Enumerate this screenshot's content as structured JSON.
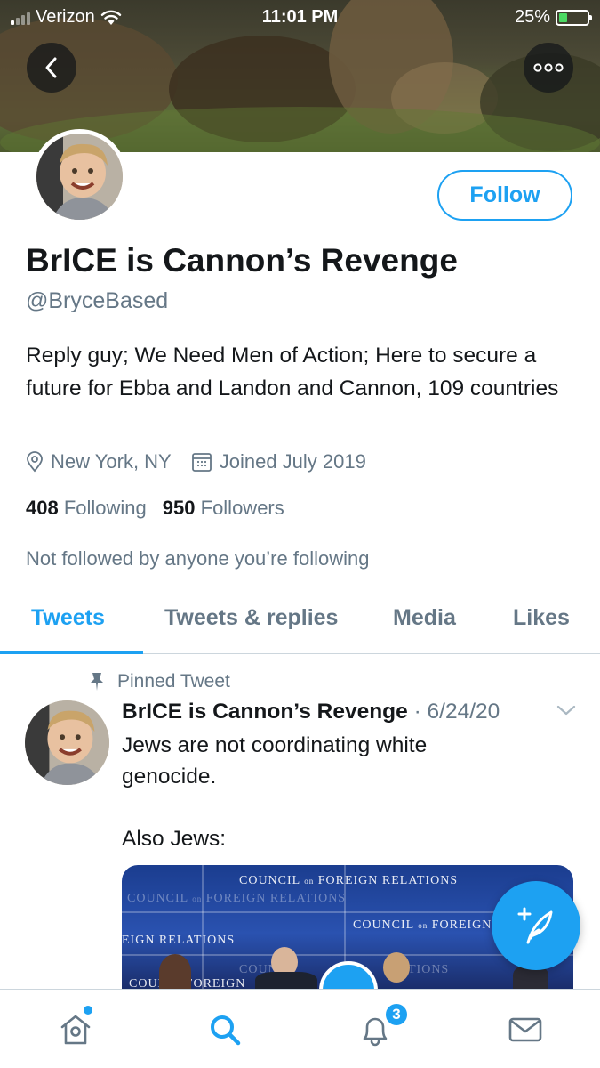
{
  "status_bar": {
    "carrier": "Verizon",
    "time": "11:01 PM",
    "battery_percent": "25%",
    "battery_level": 0.25
  },
  "header": {
    "back_icon": "chevron-left-icon",
    "more_icon": "more-dots-icon"
  },
  "profile": {
    "display_name": "BrICE is Cannon’s Revenge",
    "handle": "@BryceBased",
    "follow_label": "Follow",
    "bio": "Reply guy; We Need Men of Action; Here to secure a future for Ebba and Landon and Cannon, 109 countries",
    "location": "New York, NY",
    "joined": "Joined July 2019",
    "following_count": "408",
    "following_label": "Following",
    "followers_count": "950",
    "followers_label": "Followers",
    "not_followed": "Not followed by anyone you’re following"
  },
  "tabs": [
    {
      "label": "Tweets",
      "active": true
    },
    {
      "label": "Tweets & replies",
      "active": false
    },
    {
      "label": "Media",
      "active": false
    },
    {
      "label": "Likes",
      "active": false
    }
  ],
  "pinned_tweet": {
    "pinned_label": "Pinned Tweet",
    "author": "BrICE is Cannon’s Revenge",
    "date": "6/24/20",
    "text_line1": "Jews are not coordinating white",
    "text_line2": "genocide.",
    "text_line3": "Also Jews:",
    "media_text": {
      "council": "COUNCIL",
      "on": "on",
      "foreign": "FOREIGN",
      "relations": "RELATIONS",
      "eign_relations": "EIGN RELATIONS",
      "coun": "COUN",
      "tions": "TIONS"
    }
  },
  "bottom_nav": {
    "home_icon": "home-icon",
    "search_icon": "search-icon",
    "notifications_icon": "bell-icon",
    "notifications_badge": "3",
    "messages_icon": "mail-icon"
  },
  "colors": {
    "accent": "#1da1f2",
    "text_primary": "#14171a",
    "text_secondary": "#657786",
    "divider": "#ccd6dd"
  }
}
